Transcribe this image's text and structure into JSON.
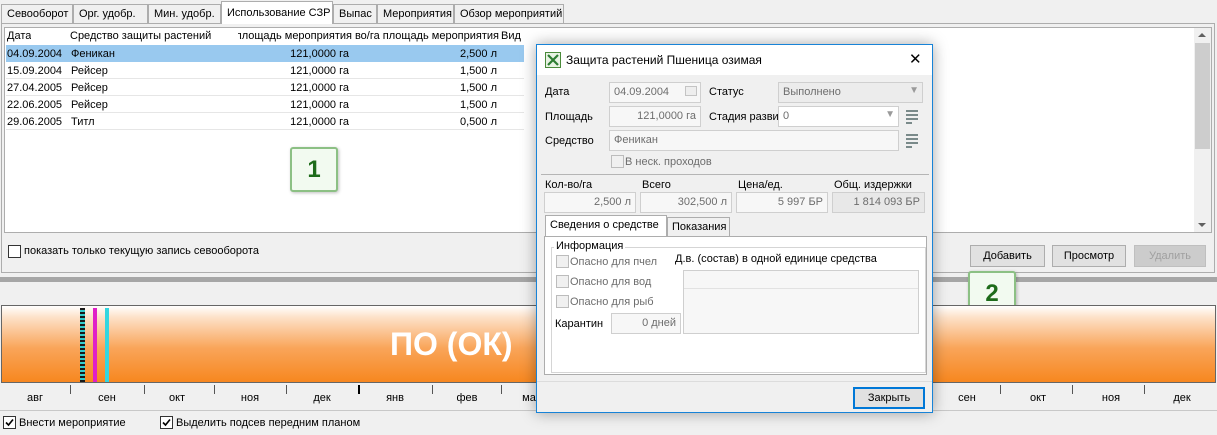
{
  "tabs": [
    "Севооборот",
    "Орг. удобр.",
    "Мин. удобр.",
    "Использование СЗР",
    "Выпас",
    "Мероприятия",
    "Обзор мероприятий"
  ],
  "active_tab": "Использование СЗР",
  "table": {
    "columns": [
      "Дата",
      "Средство защиты растений",
      "площадь мероприятия",
      "во/га площадь мероприятия",
      "Вид"
    ],
    "rows": [
      {
        "date": "04.09.2004",
        "product": "Феникан",
        "area": "121,0000 га",
        "qty": "2,500 л",
        "selected": true
      },
      {
        "date": "15.09.2004",
        "product": "Рейсер",
        "area": "121,0000 га",
        "qty": "1,500 л"
      },
      {
        "date": "27.04.2005",
        "product": "Рейсер",
        "area": "121,0000 га",
        "qty": "1,500 л"
      },
      {
        "date": "22.06.2005",
        "product": "Рейсер",
        "area": "121,0000 га",
        "qty": "1,500 л"
      },
      {
        "date": "29.06.2005",
        "product": "Титл",
        "area": "121,0000 га",
        "qty": "0,500 л"
      }
    ]
  },
  "show_current_label": "показать только текущую запись севооборота",
  "buttons": {
    "add": "Добавить",
    "view": "Просмотр",
    "delete": "Удалить"
  },
  "callouts": {
    "one": "1",
    "two": "2"
  },
  "timeline": {
    "label": "ПО (ОК)",
    "months": [
      "авг",
      "сен",
      "окт",
      "ноя",
      "дек",
      "янв",
      "фев",
      "ма",
      "сен",
      "окт",
      "ноя",
      "дек"
    ]
  },
  "bottom": {
    "enter_measure": "Внести мероприятие",
    "highlight": "Выделить подсев передним планом"
  },
  "dialog": {
    "title": "Защита растений Пшеница озимая",
    "close_symbol": "✕",
    "date_label": "Дата",
    "date_value": "04.09.2004",
    "status_label": "Статус",
    "status_value": "Выполнено",
    "area_label": "Площадь",
    "area_value": "121,0000 га",
    "stage_label": "Стадия разви",
    "stage_value": "0",
    "product_label": "Средство",
    "product_value": "Феникан",
    "multi_pass_label": "В неск. проходов",
    "qty_label": "Кол-во/га",
    "qty_value": "2,500 л",
    "total_label": "Всего",
    "total_value": "302,500 л",
    "price_label": "Цена/ед.",
    "price_value": "5 997 БР",
    "cost_label": "Общ. издержки",
    "cost_value": "1 814 093 БР",
    "tabs": [
      "Сведения о средстве",
      "Показания"
    ],
    "info_label": "Информация",
    "bees_label": "Опасно для пчел",
    "water_label": "Опасно для вод",
    "fish_label": "Опасно для рыб",
    "quarantine_label": "Карантин",
    "quarantine_value": "0 дней",
    "ai_label": "Д.в. (состав) в одной единице средства",
    "close_button": "Закрыть"
  },
  "colors": {
    "selection": "#99c9ef",
    "accent": "#0078d7",
    "timeline_orange": "#f7871f",
    "callout_green": "#1e6b1a"
  }
}
